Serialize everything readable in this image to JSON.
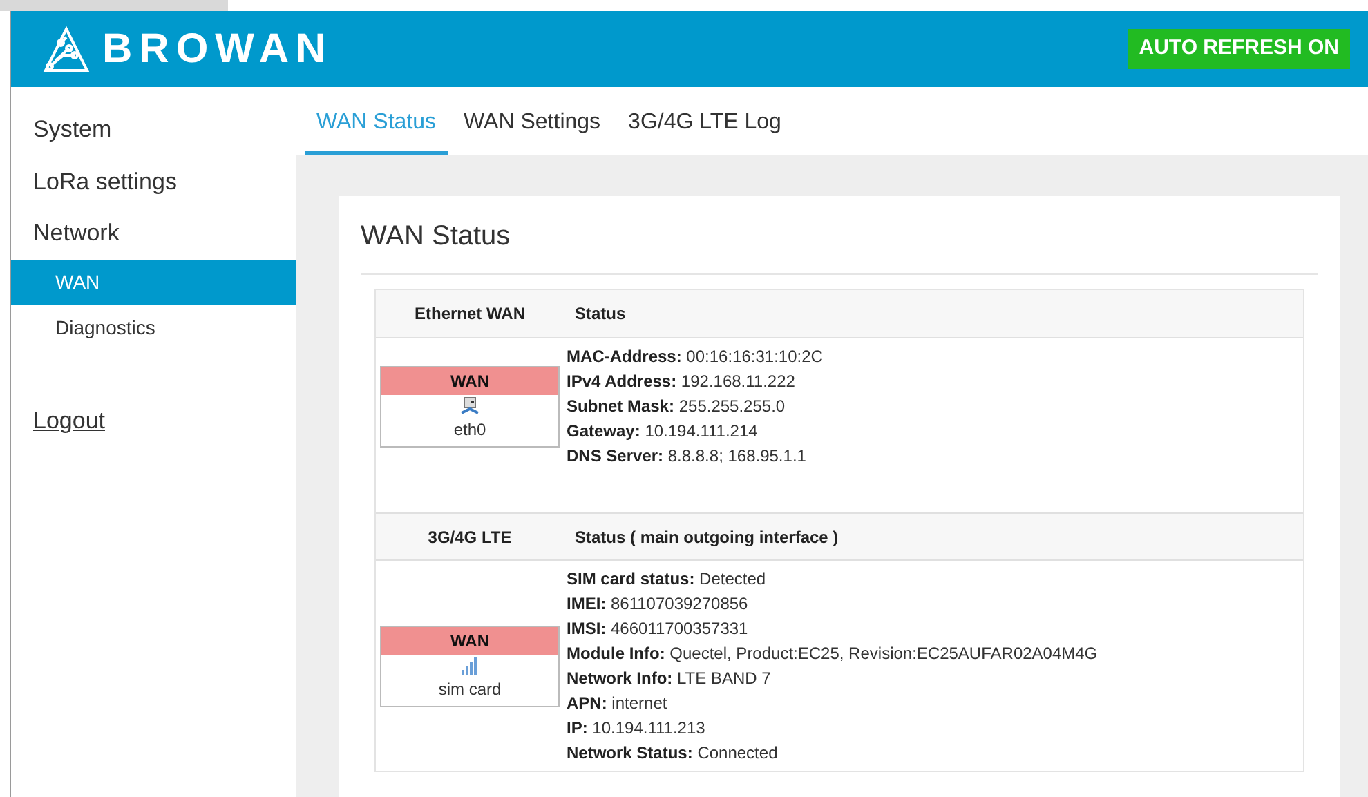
{
  "header": {
    "logo": "BROWAN",
    "auto_refresh": "AUTO REFRESH ON"
  },
  "sidebar": {
    "items": [
      {
        "label": "System",
        "selected": false
      },
      {
        "label": "LoRa settings",
        "selected": false
      },
      {
        "label": "Network",
        "selected": false,
        "children": [
          {
            "label": "WAN",
            "selected": true
          },
          {
            "label": "Diagnostics",
            "selected": false
          }
        ]
      }
    ],
    "logout": "Logout"
  },
  "tabs": [
    {
      "label": "WAN Status",
      "selected": true
    },
    {
      "label": "WAN Settings",
      "selected": false
    },
    {
      "label": "3G/4G LTE Log",
      "selected": false
    }
  ],
  "panel": {
    "title": "WAN Status",
    "sections": [
      {
        "columns": [
          "Ethernet WAN",
          "Status"
        ],
        "interface": {
          "badge": "WAN",
          "kind": "ethernet",
          "name": "eth0"
        },
        "lines": [
          "**MAC-Address:** 00:16:16:31:10:2C",
          "**IPv4 Address:** 192.168.11.222",
          "**Subnet Mask:** 255.255.255.0",
          "**Gateway:** 10.194.111.214",
          "**DNS Server:** 8.8.8.8; 168.95.1.1"
        ]
      },
      {
        "columns": [
          "3G/4G LTE",
          "Status ( main outgoing interface )"
        ],
        "interface": {
          "badge": "WAN",
          "kind": "cellular",
          "name": "sim card"
        },
        "lines": [
          "**SIM card status:** Detected",
          "**IMEI:** 861107039270856",
          "**IMSI:** 466011700357331",
          "**Module Info:** Quectel, Product:EC25, Revision:EC25AUFAR02A04M4G",
          "**Network Info:** LTE BAND 7",
          "**APN:** internet",
          "**IP:** 10.194.111.213",
          "**Network Status:** Connected"
        ]
      }
    ]
  }
}
